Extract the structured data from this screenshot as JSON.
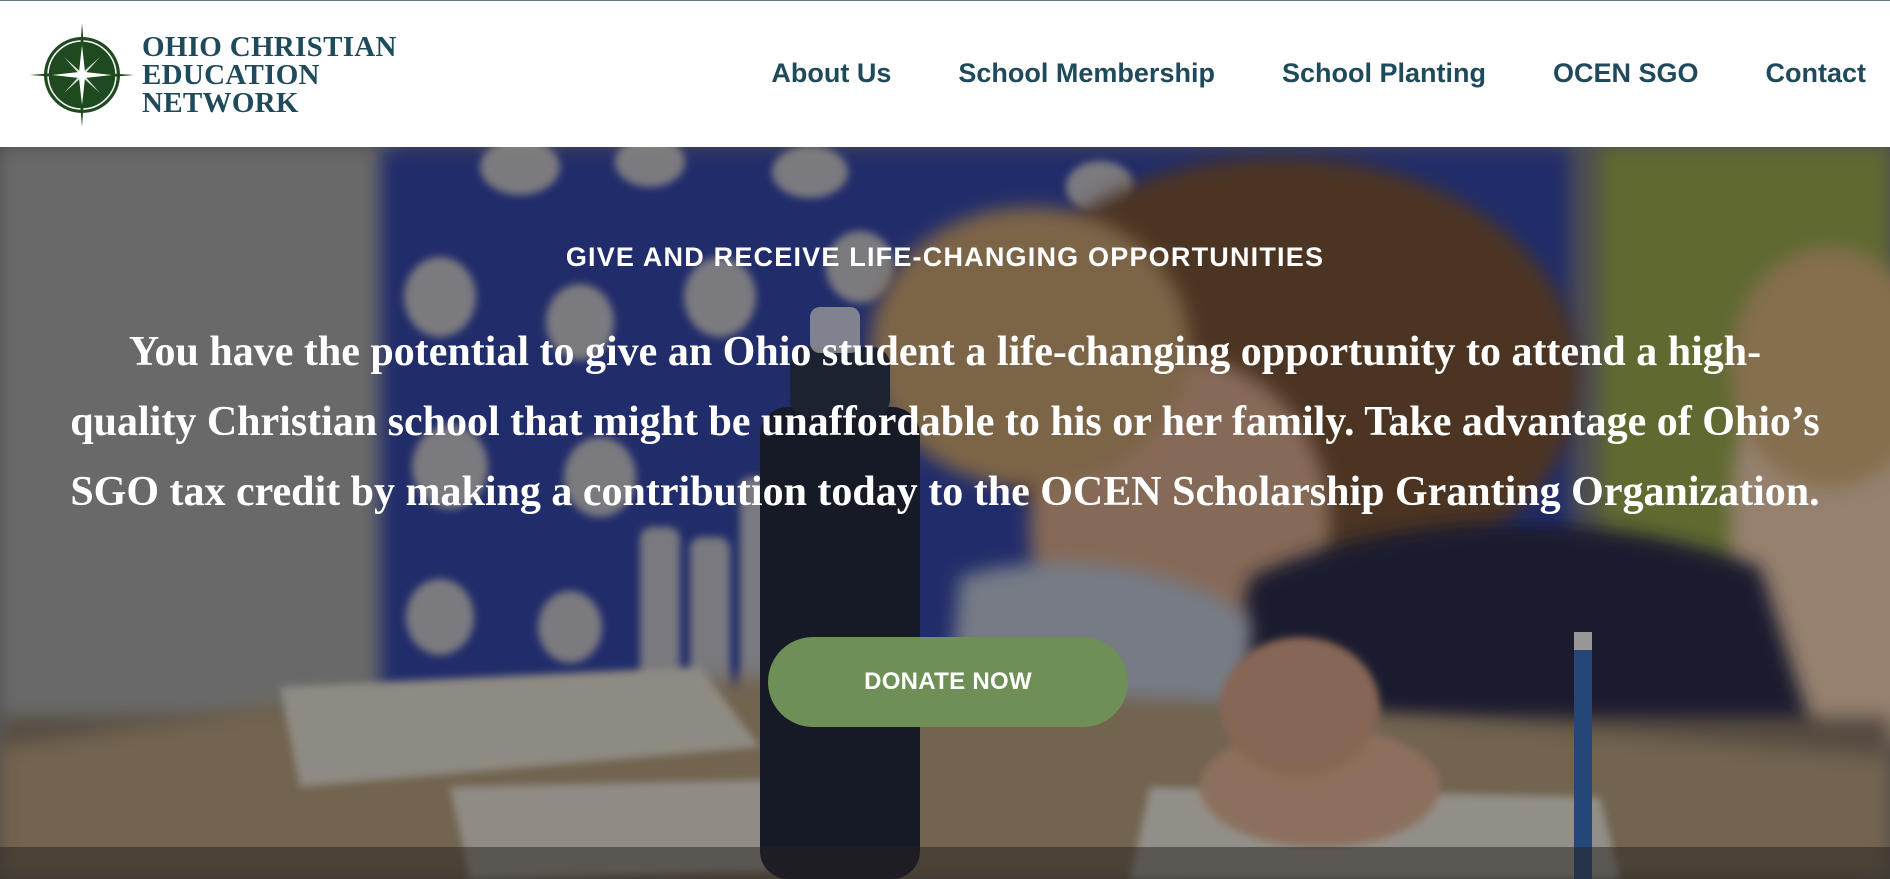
{
  "site": {
    "logo_lines": [
      "OHIO CHRISTIAN",
      "EDUCATION",
      "NETWORK"
    ],
    "logo_icon": "compass-star-icon",
    "brand_color": "#1f4a5b",
    "logo_green": "#1f4a1f"
  },
  "nav": {
    "items": [
      {
        "label": "About Us"
      },
      {
        "label": "School Membership"
      },
      {
        "label": "School Planting"
      },
      {
        "label": "OCEN SGO"
      },
      {
        "label": "Contact"
      }
    ]
  },
  "hero": {
    "eyebrow": "GIVE AND RECEIVE LIFE-CHANGING OPPORTUNITIES",
    "headline": "You have the potential to give an Ohio student a life-changing opportunity to attend a high-quality Christian school that might be unaffordable to his or her family. Take advantage of Ohio’s SGO tax credit by making a contribution today to the OCEN Scholarship Granting Organization.",
    "cta_label": "DONATE NOW",
    "cta_color": "#6e8f55"
  }
}
